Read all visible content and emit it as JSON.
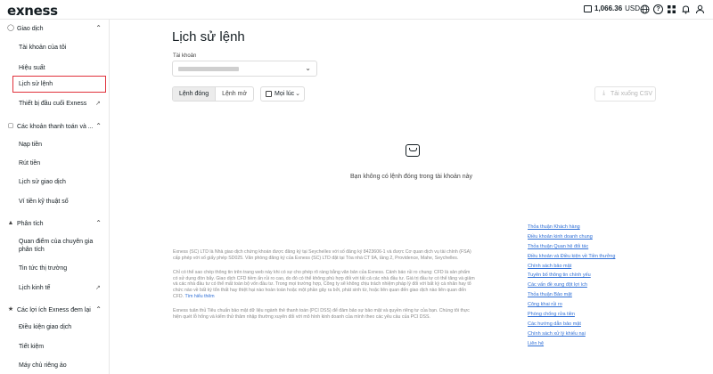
{
  "header": {
    "logo": "exness",
    "balance": "1,066.36",
    "currency": "USD"
  },
  "sidebar": {
    "sections": [
      {
        "label": "Giao dịch",
        "icon": "trade-icon",
        "items": [
          {
            "label": "Tài khoản của tôi"
          },
          {
            "label": "Hiệu suất"
          },
          {
            "label": "Lịch sử lệnh",
            "active": true
          },
          {
            "label": "Thiết bị đầu cuối Exness",
            "external": true
          }
        ]
      },
      {
        "label": "Các khoản thanh toán và ...",
        "icon": "wallet-icon",
        "items": [
          {
            "label": "Nạp tiền"
          },
          {
            "label": "Rút tiền"
          },
          {
            "label": "Lịch sử giao dịch"
          },
          {
            "label": "Ví tiền kỹ thuật số"
          }
        ]
      },
      {
        "label": "Phân tích",
        "icon": "analytics-icon",
        "items": [
          {
            "label": "Quan điểm của chuyên gia phân tích"
          },
          {
            "label": "Tin tức thị trường"
          },
          {
            "label": "Lịch kinh tế",
            "external": true
          }
        ]
      },
      {
        "label": "Các lợi ích Exness đem lại",
        "icon": "benefits-icon",
        "items": [
          {
            "label": "Điều kiện giao dịch"
          },
          {
            "label": "Tiết kiệm"
          },
          {
            "label": "Máy chủ riêng ảo"
          }
        ]
      }
    ]
  },
  "main": {
    "title": "Lịch sử lệnh",
    "account_label": "Tài khoản",
    "tabs": [
      {
        "label": "Lệnh đóng",
        "active": true
      },
      {
        "label": "Lệnh mở"
      }
    ],
    "date_filter": "Mọi lúc",
    "download_label": "Tải xuống CSV",
    "empty_message": "Bạn không có lệnh đóng trong tài khoản này"
  },
  "footer": {
    "paragraph1": "Exness (SC) LTD là Nhà giao dịch chứng khoán được đăng ký tại Seychelles với số đăng ký 8423606-1 và được Cơ quan dịch vụ tài chính (FSA) cấp phép với số giấy phép SD025. Văn phòng đăng ký của Exness (SC) LTD đặt tại Tòa nhà CT 9A, tầng 2, Providence, Mahe, Seychelles.",
    "paragraph2": "Chỉ có thể sao chép thông tin trên trang web này khi có sự cho phép rõ ràng bằng văn bản của Exness. Cảnh báo rủi ro chung: CFD là sản phẩm có sử dụng đòn bẩy. Giao dịch CFD tiềm ẩn rủi ro cao, do đó có thể không phù hợp đối với tất cả các nhà đầu tư. Giá trị đầu tư có thể tăng và giảm và các nhà đầu tư có thể mất toàn bộ vốn đầu tư. Trong mọi trường hợp, Công ty sẽ không chịu trách nhiệm pháp lý đối với bất kỳ cá nhân hay tổ chức nào về bất kỳ tổn thất hay thiệt hại nào hoàn toàn hoặc một phần gây ra bởi, phát sinh từ, hoặc liên quan đến giao dịch nào liên quan đến CFD.",
    "paragraph2_link": "Tìm hiểu thêm",
    "paragraph3": "Exness tuân thủ Tiêu chuẩn bảo mật dữ liệu ngành thẻ thanh toán (PCI DSS) để đảm bảo sự bảo mật và quyền riêng tư của bạn. Chúng tôi thực hiện quét lỗ hổng và kiểm thử thâm nhập thường xuyên đối với mô hình kinh doanh của mình theo các yêu cầu của PCI DSS.",
    "links": [
      "Thỏa thuận Khách hàng",
      "Điều khoản kinh doanh chung",
      "Thỏa thuận Quan hệ đối tác",
      "Điều khoản và Điều kiện về Tiền thưởng",
      "Chính sách bảo mật",
      "Tuyên bố thông tin chính yếu",
      "Các vấn đề xung đột lợi ích",
      "Thỏa thuận Bảo mật",
      "Công khai rủi ro",
      "Phòng chống rửa tiền",
      "Các hướng dẫn bảo mật",
      "Chính sách xử lý khiếu nại",
      "Liên hệ"
    ]
  }
}
